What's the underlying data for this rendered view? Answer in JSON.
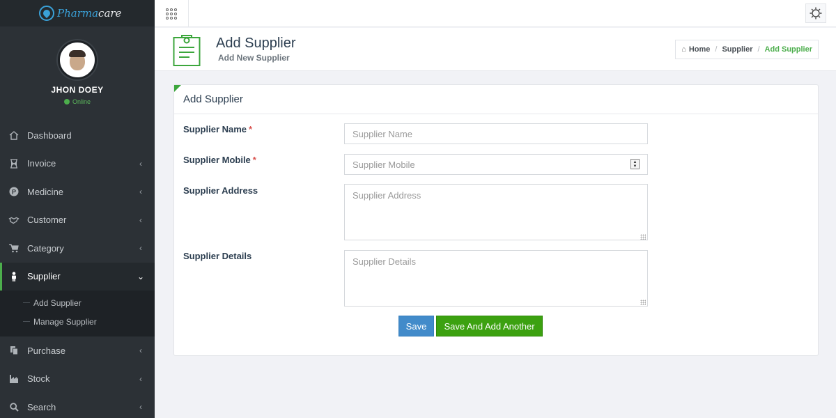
{
  "brand": {
    "name_part1": "Pharma",
    "name_part2": "care"
  },
  "user": {
    "name": "JHON DOEY",
    "status": "Online"
  },
  "sidebar": {
    "items": [
      {
        "label": "Dashboard",
        "icon": "home-icon",
        "has_children": false
      },
      {
        "label": "Invoice",
        "icon": "hourglass-icon",
        "has_children": true
      },
      {
        "label": "Medicine",
        "icon": "pharmacy-icon",
        "has_children": true
      },
      {
        "label": "Customer",
        "icon": "handshake-icon",
        "has_children": true
      },
      {
        "label": "Category",
        "icon": "cart-icon",
        "has_children": true
      },
      {
        "label": "Supplier",
        "icon": "person-icon",
        "has_children": true,
        "expanded": true
      },
      {
        "label": "Purchase",
        "icon": "copy-icon",
        "has_children": true
      },
      {
        "label": "Stock",
        "icon": "industry-icon",
        "has_children": true
      },
      {
        "label": "Search",
        "icon": "search-icon",
        "has_children": true
      }
    ],
    "submenu": [
      "Add Supplier",
      "Manage Supplier"
    ]
  },
  "header": {
    "title": "Add Supplier",
    "subtitle": "Add New Supplier",
    "breadcrumb": [
      "Home",
      "Supplier",
      "Add Supplier"
    ]
  },
  "form": {
    "title": "Add Supplier",
    "fields": [
      {
        "label": "Supplier Name",
        "required_mark": "*",
        "placeholder": "Supplier Name"
      },
      {
        "label": "Supplier Mobile",
        "required_mark": "*",
        "placeholder": "Supplier Mobile"
      },
      {
        "label": "Supplier Address",
        "placeholder": "Supplier Address"
      },
      {
        "label": "Supplier Details",
        "placeholder": "Supplier Details"
      }
    ],
    "save_label": "Save",
    "save_another_label": "Save And Add Another"
  },
  "colors": {
    "sidebar_bg": "#2c3136",
    "accent_green": "#4cae4c",
    "primary_blue": "#428bca",
    "success_green": "#3ca110"
  }
}
